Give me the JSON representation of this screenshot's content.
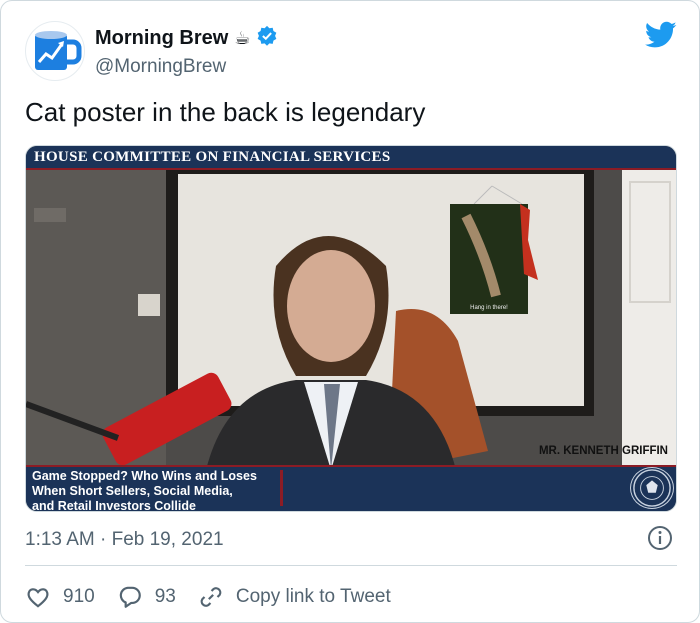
{
  "account": {
    "display_name": "Morning Brew",
    "emoji": "☕",
    "handle": "@MorningBrew",
    "verified": true
  },
  "tweet": {
    "text": "Cat poster in the back is legendary",
    "timestamp": "1:13 AM · Feb 19, 2021"
  },
  "media": {
    "top_banner": "HOUSE COMMITTEE ON FINANCIAL SERVICES",
    "hearing_title_lines": [
      "Game Stopped? Who Wins and Loses",
      "When Short Sellers, Social Media,",
      "and Retail Investors Collide"
    ],
    "speaker": "MR. KENNETH GRIFFIN",
    "poster_caption": "Hang in there!"
  },
  "actions": {
    "likes": "910",
    "replies": "93",
    "copy_link": "Copy link to Tweet"
  },
  "colors": {
    "twitter_blue": "#1d9bf0",
    "secondary_text": "#536471",
    "banner_navy": "#1b3358",
    "banner_red": "#8c1c25"
  },
  "icons": [
    "twitter-bird-icon",
    "verified-badge-icon",
    "info-icon",
    "heart-icon",
    "reply-icon",
    "link-icon"
  ]
}
